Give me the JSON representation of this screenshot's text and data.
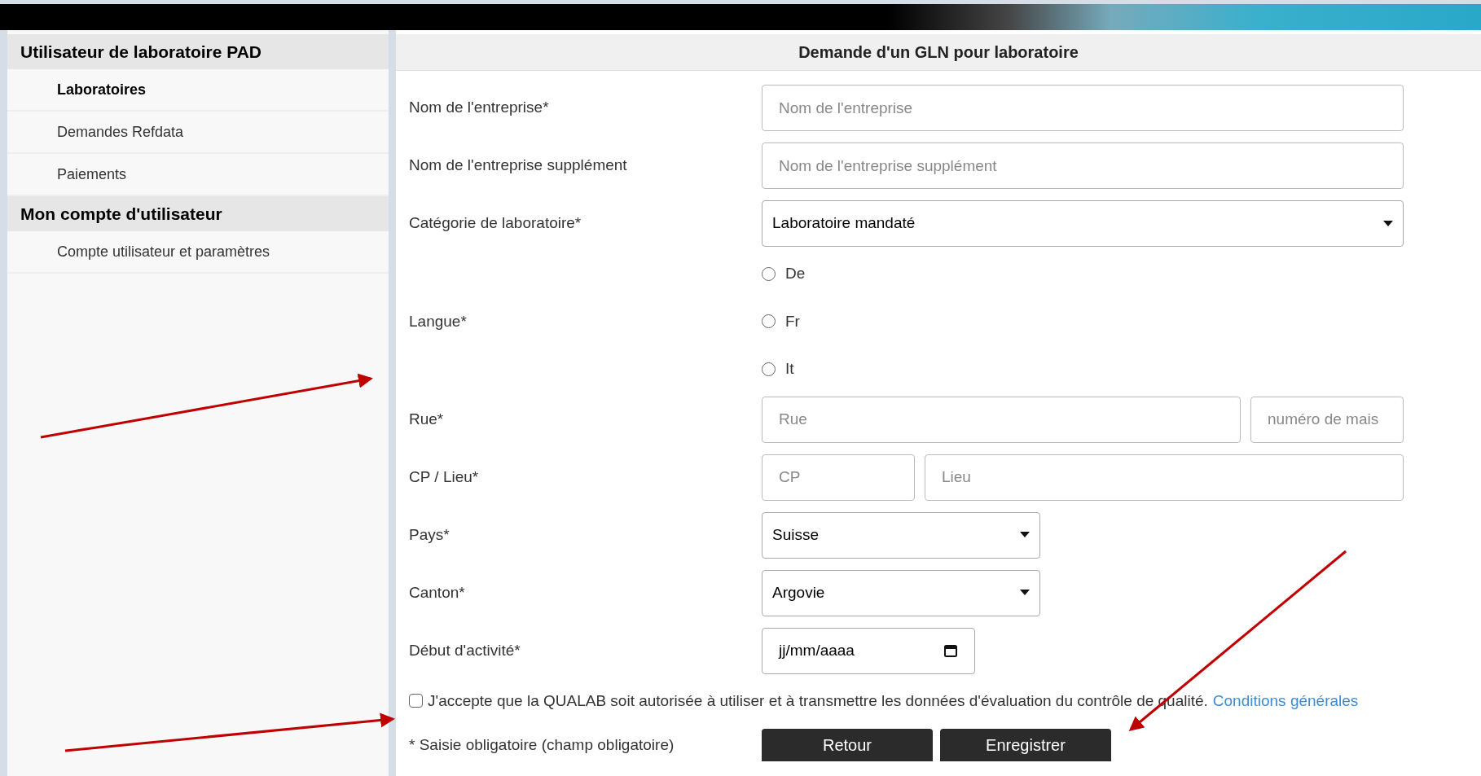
{
  "sidebar": {
    "sections": [
      {
        "title": "Utilisateur de laboratoire PAD",
        "items": [
          {
            "label": "Laboratoires",
            "selected": true
          },
          {
            "label": "Demandes Refdata",
            "selected": false
          },
          {
            "label": "Paiements",
            "selected": false
          }
        ]
      },
      {
        "title": "Mon compte d'utilisateur",
        "items": [
          {
            "label": "Compte utilisateur et paramètres",
            "selected": false
          }
        ]
      }
    ]
  },
  "form": {
    "title": "Demande d'un GLN pour laboratoire",
    "rows": [
      {
        "kind": "text",
        "label": "Nom de l'entreprise*",
        "fields": [
          {
            "placeholder": "Nom de l'entreprise"
          }
        ]
      },
      {
        "kind": "text",
        "label": "Nom de l'entreprise supplément",
        "fields": [
          {
            "placeholder": "Nom de l'entreprise supplément"
          }
        ]
      },
      {
        "kind": "select",
        "label": "Catégorie de laboratoire*",
        "value": "Laboratoire mandaté"
      },
      {
        "kind": "radio",
        "label": "Langue*",
        "options": [
          {
            "label": "De",
            "selected": false
          },
          {
            "label": "Fr",
            "selected": false
          },
          {
            "label": "It",
            "selected": false
          }
        ]
      },
      {
        "kind": "text",
        "label": "Rue*",
        "fields": [
          {
            "placeholder": "Rue"
          },
          {
            "placeholder": "numéro de mais"
          }
        ]
      },
      {
        "kind": "text",
        "label": "CP / Lieu*",
        "fields": [
          {
            "placeholder": "CP"
          },
          {
            "placeholder": "Lieu"
          }
        ]
      },
      {
        "kind": "select_short",
        "label": "Pays*",
        "value": "Suisse"
      },
      {
        "kind": "select_short",
        "label": "Canton*",
        "value": "Argovie"
      },
      {
        "kind": "date",
        "label": "Début d'activité*",
        "value": "jj/mm/aaaa"
      }
    ],
    "consent": {
      "checked": false,
      "text": "J'accepte que la QUALAB soit autorisée à utiliser et à transmettre les données d'évaluation du contrôle de qualité.",
      "link": "Conditions générales"
    },
    "footnote": "* Saisie obligatoire (champ obligatoire)",
    "buttons": [
      "Retour",
      "Enregistrer"
    ]
  }
}
